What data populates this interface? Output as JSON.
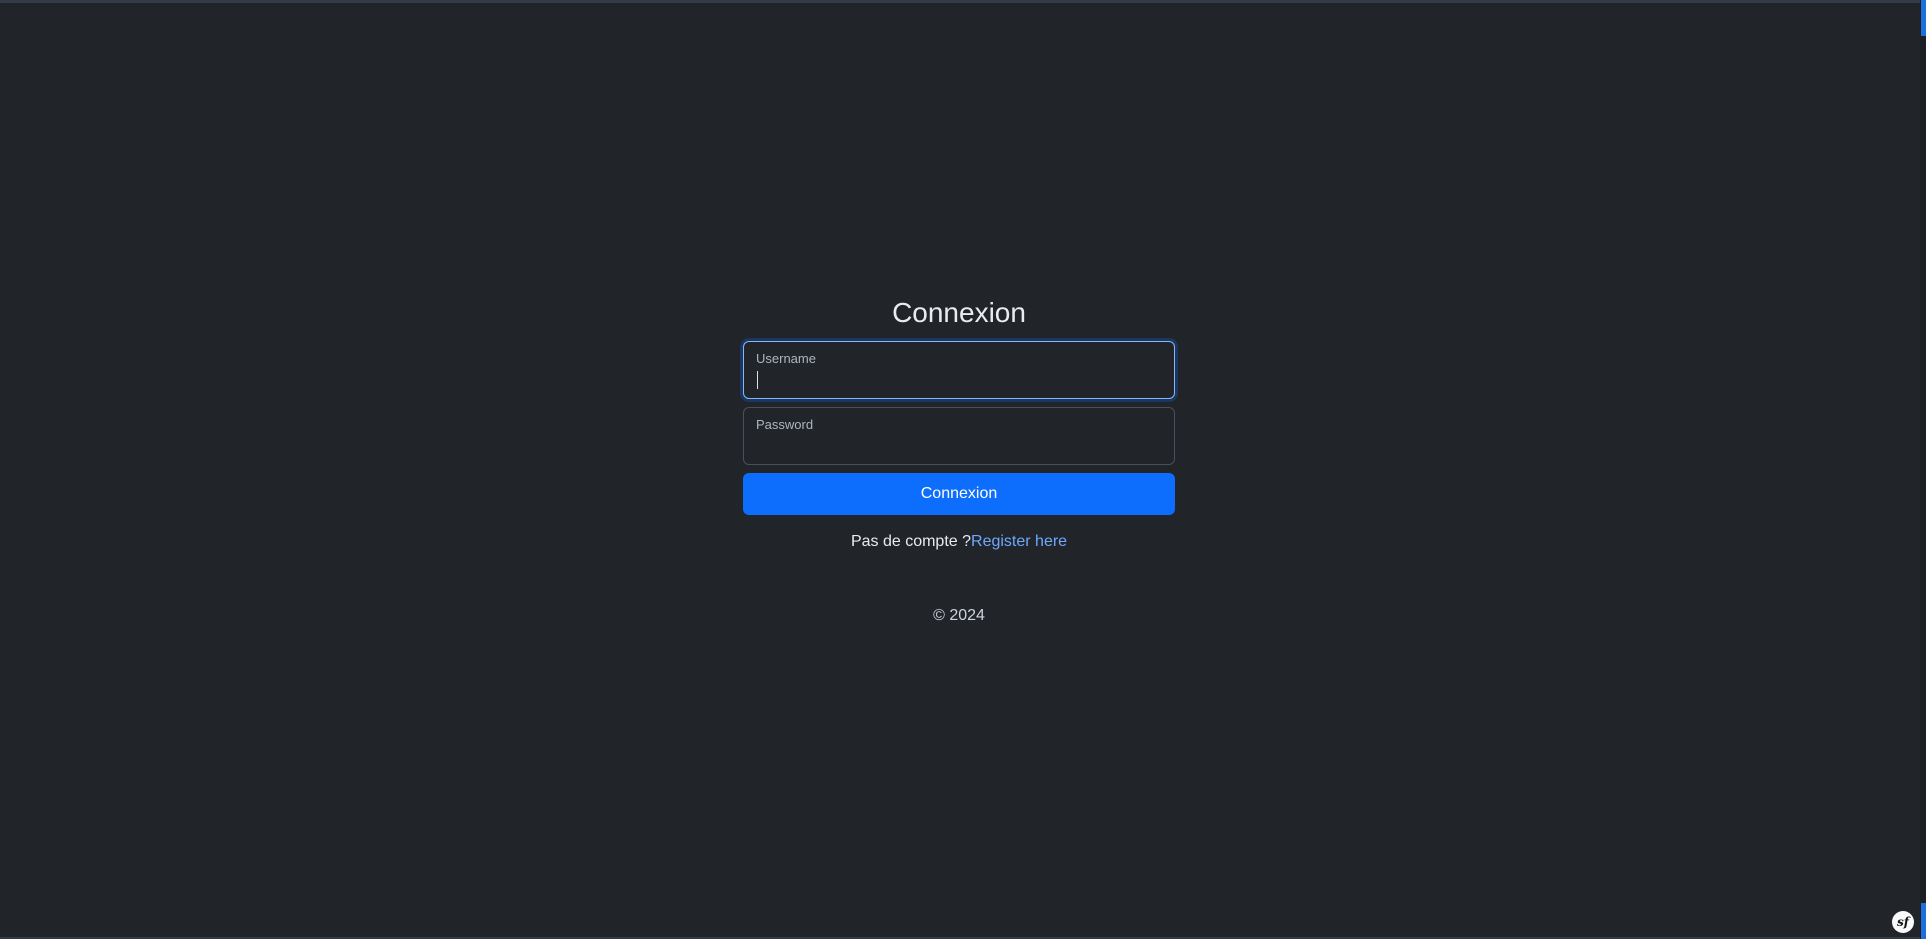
{
  "page": {
    "title": "Connexion"
  },
  "form": {
    "username_label": "Username",
    "username_value": "",
    "password_label": "Password",
    "password_value": "",
    "submit_label": "Connexion"
  },
  "register": {
    "prompt": "Pas de compte ?",
    "link_label": "Register here"
  },
  "footer": {
    "copyright": "© 2024"
  },
  "toolbar": {
    "badge_text": "sf",
    "badge_icon": "symfony-icon"
  },
  "colors": {
    "background": "#212529",
    "primary": "#0d6efd",
    "link": "#6ea8fe",
    "focus_border": "#86b7fe"
  }
}
